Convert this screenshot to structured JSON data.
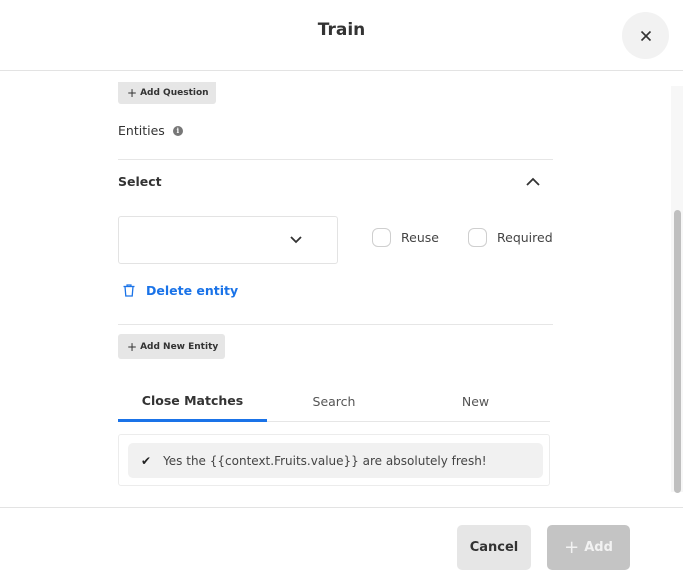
{
  "header": {
    "title": "Train",
    "close_icon": "close-icon"
  },
  "body": {
    "add_question_label": "Add Question",
    "entities_label": "Entities",
    "info_icon": "i",
    "section_title": "Select",
    "dropdown": {
      "value": ""
    },
    "checkboxes": [
      {
        "label": "Reuse",
        "checked": false
      },
      {
        "label": "Required",
        "checked": false
      }
    ],
    "delete_entity_label": "Delete entity",
    "add_new_entity_label": "Add New Entity",
    "tabs": [
      {
        "label": "Close Matches",
        "active": true
      },
      {
        "label": "Search",
        "active": false
      },
      {
        "label": "New",
        "active": false
      }
    ],
    "matches": [
      {
        "check": "✔",
        "text": "Yes the {{context.Fruits.value}} are absolutely fresh!"
      }
    ]
  },
  "footer": {
    "cancel_label": "Cancel",
    "add_label": "Add",
    "plus": "+"
  },
  "colors": {
    "accent": "#1a73e8",
    "button_gray": "#e6e6e6",
    "button_disabled": "#c4c4c4"
  }
}
